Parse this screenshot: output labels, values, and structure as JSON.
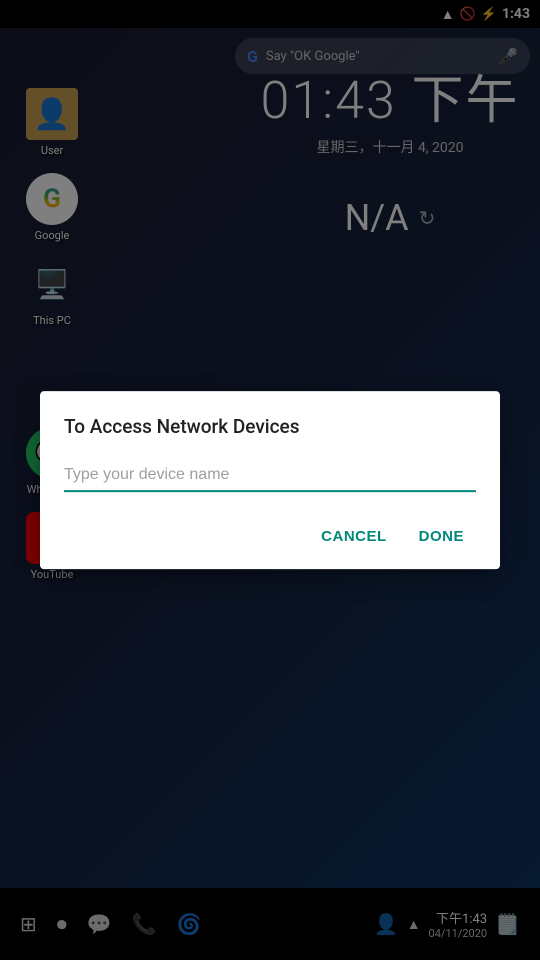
{
  "statusBar": {
    "time": "1:43",
    "wifiIcon": "wifi",
    "signalIcon": "signal",
    "batteryIcon": "battery"
  },
  "desktop": {
    "searchBar": {
      "placeholder": "Say \"OK Google\"",
      "micLabel": "mic"
    },
    "clock": {
      "time": "01:43 下午",
      "date": "星期三，十一月 4, 2020"
    },
    "weather": {
      "value": "N/A",
      "refreshLabel": "refresh"
    },
    "appIcons": [
      {
        "label": "User",
        "type": "user"
      },
      {
        "label": "Google",
        "type": "google"
      },
      {
        "label": "This PC",
        "type": "pc"
      },
      {
        "label": "WhatsApp",
        "type": "whatsapp"
      },
      {
        "label": "YouTube",
        "type": "youtube"
      }
    ]
  },
  "dialog": {
    "title": "To Access Network Devices",
    "inputPlaceholder": "Type your device name",
    "cancelLabel": "CANCEL",
    "doneLabel": "DONE"
  },
  "navBar": {
    "timeLabel": "下午1:43",
    "dateLabel": "04/11/2020",
    "icons": [
      "windows",
      "record",
      "chat",
      "phone",
      "browser",
      "user",
      "chevron-up",
      "notification"
    ]
  }
}
